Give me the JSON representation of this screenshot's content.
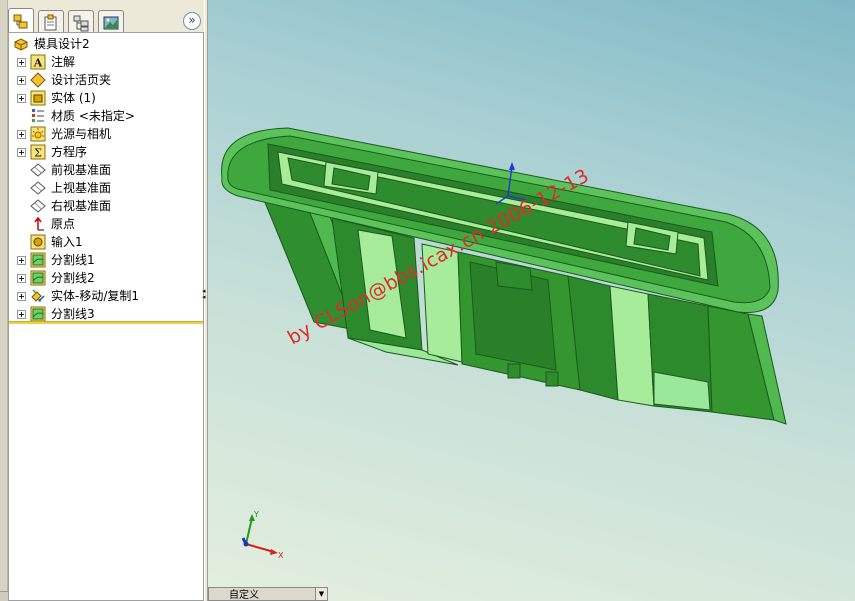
{
  "feature_manager": {
    "tabs": [
      {
        "icon": "feature-tree-icon",
        "active": true
      },
      {
        "icon": "property-manager-icon",
        "active": false
      },
      {
        "icon": "configuration-manager-icon",
        "active": false
      },
      {
        "icon": "display-manager-icon",
        "active": false
      }
    ],
    "expand_glyph": "»",
    "root": {
      "label": "模具设计2",
      "icon": "part-icon"
    },
    "items": [
      {
        "label": "注解",
        "icon": "annotation-icon",
        "expandable": true
      },
      {
        "label": "设计活页夹",
        "icon": "design-binder-icon",
        "expandable": true
      },
      {
        "label": "实体 (1)",
        "icon": "solid-bodies-icon",
        "expandable": true
      },
      {
        "label": "材质 <未指定>",
        "icon": "material-icon",
        "expandable": false
      },
      {
        "label": "光源与相机",
        "icon": "lights-cameras-icon",
        "expandable": true
      },
      {
        "label": "方程序",
        "icon": "equations-icon",
        "expandable": true
      },
      {
        "label": "前视基准面",
        "icon": "plane-icon",
        "expandable": false
      },
      {
        "label": "上视基准面",
        "icon": "plane-icon",
        "expandable": false
      },
      {
        "label": "右视基准面",
        "icon": "plane-icon",
        "expandable": false
      },
      {
        "label": "原点",
        "icon": "origin-icon",
        "expandable": false
      },
      {
        "label": "输入1",
        "icon": "imported-body-icon",
        "expandable": false
      },
      {
        "label": "分割线1",
        "icon": "split-line-icon",
        "expandable": true
      },
      {
        "label": "分割线2",
        "icon": "split-line-icon",
        "expandable": true
      },
      {
        "label": "实体-移动/复制1",
        "icon": "move-copy-body-icon",
        "expandable": true
      },
      {
        "label": "分割线3",
        "icon": "split-line-icon",
        "expandable": true
      }
    ]
  },
  "viewport": {
    "watermark": "by CLSon@bbs.icax.cn 2006-12-13",
    "triad": {
      "x": "X",
      "y": "Y"
    },
    "view_selector": "自定义"
  },
  "colors": {
    "model_dark": "#2e8b2e",
    "model_light": "#8fe28f",
    "watermark": "#e02b2b"
  }
}
